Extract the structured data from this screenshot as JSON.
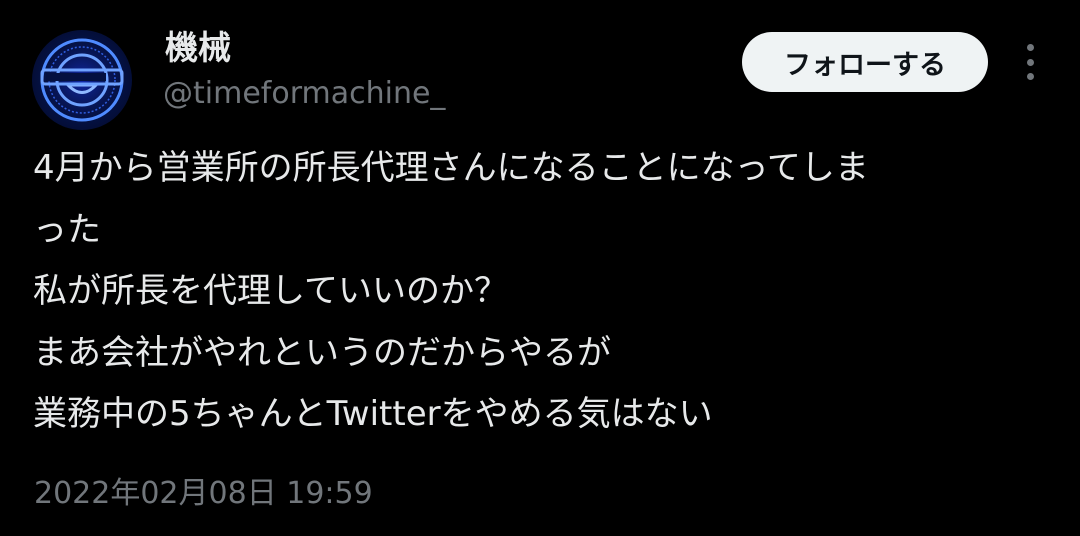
{
  "author": {
    "display_name": "機械",
    "handle": "@timeformachine_",
    "avatar_icon": "laughing-man-logo-icon",
    "avatar_logo_text": "I thought what I'd do was I'd pretend I was one of those deaf-mutes"
  },
  "actions": {
    "follow_label": "フォローする",
    "more_icon": "more-vertical-icon"
  },
  "tweet": {
    "lines": [
      "4月から営業所の所長代理さんになることになってしま",
      "った",
      "私が所長を代理していいのか？",
      "まあ会社がやれというのだからやるが",
      "業務中の5ちゃんとTwitterをやめる気はない"
    ],
    "timestamp": "2022年02月08日 19:59"
  },
  "colors": {
    "background": "#000000",
    "primary_text": "#e7e9ea",
    "secondary_text": "#71767b",
    "button_bg": "#eff3f4",
    "button_text": "#0f1419",
    "logo_blue": "#3d7bff"
  }
}
